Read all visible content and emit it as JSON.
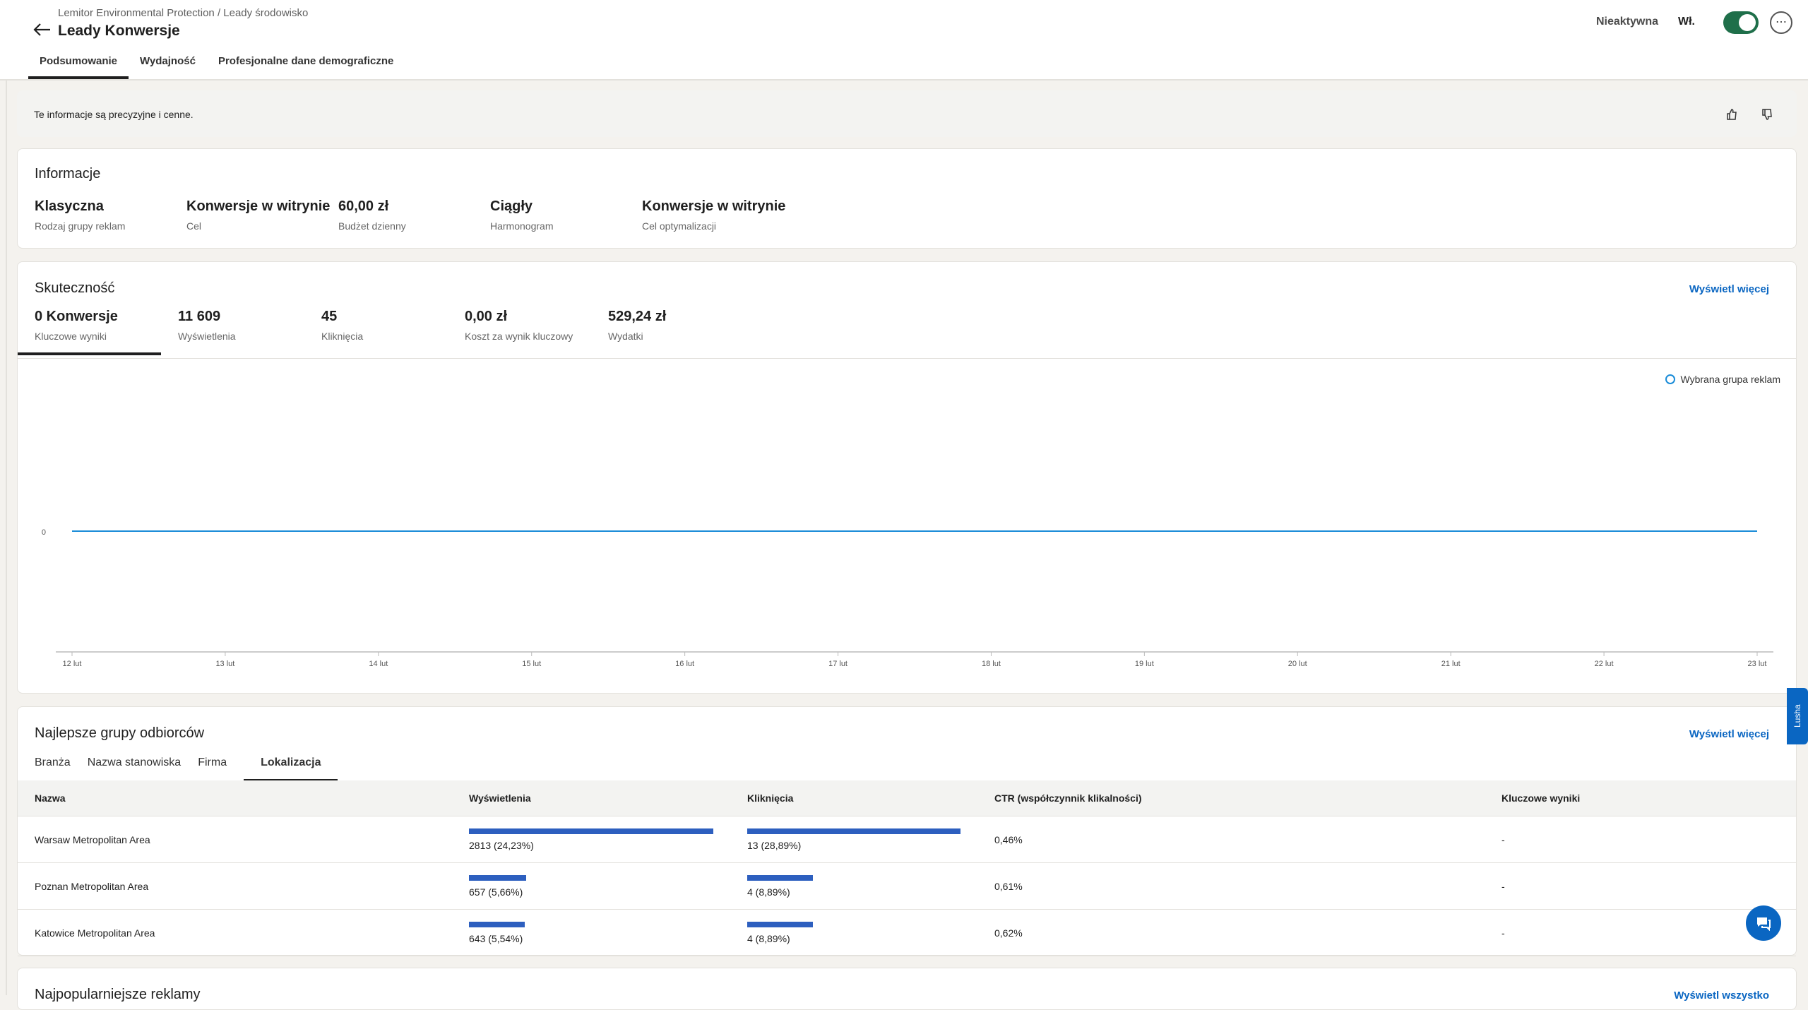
{
  "header": {
    "breadcrumb": "Lemitor Environmental Protection / Leady środowisko",
    "title": "Leady Konwersje",
    "tabs": [
      {
        "label": "Podsumowanie",
        "active": true
      },
      {
        "label": "Wydajność",
        "active": false
      },
      {
        "label": "Profesjonalne dane demograficzne",
        "active": false
      }
    ],
    "status": "Nieaktywna",
    "toggle_label": "Wł.",
    "toggle_on": true
  },
  "notice": {
    "text": "Te informacje są precyzyjne i cenne."
  },
  "info": {
    "title": "Informacje",
    "items": [
      {
        "value": "Klasyczna",
        "label": "Rodzaj grupy reklam"
      },
      {
        "value": "Konwersje w witrynie",
        "label": "Cel"
      },
      {
        "value": "60,00 zł",
        "label": "Budżet dzienny"
      },
      {
        "value": "Ciągły",
        "label": "Harmonogram"
      },
      {
        "value": "Konwersje w witrynie",
        "label": "Cel optymalizacji"
      }
    ]
  },
  "performance": {
    "title": "Skuteczność",
    "view_more": "Wyświetl więcej",
    "metrics": [
      {
        "value": "0 Konwersje",
        "label": "Kluczowe wyniki",
        "active": true
      },
      {
        "value": "11 609",
        "label": "Wyświetlenia",
        "active": false
      },
      {
        "value": "45",
        "label": "Kliknięcia",
        "active": false
      },
      {
        "value": "0,00 zł",
        "label": "Koszt za wynik kluczowy",
        "active": false
      },
      {
        "value": "529,24 zł",
        "label": "Wydatki",
        "active": false
      }
    ]
  },
  "chart_data": {
    "type": "line",
    "categories": [
      "12 lut",
      "13 lut",
      "14 lut",
      "15 lut",
      "16 lut",
      "17 lut",
      "18 lut",
      "19 lut",
      "20 lut",
      "21 lut",
      "22 lut",
      "23 lut"
    ],
    "series": [
      {
        "name": "Wybrana grupa reklam",
        "values": [
          0,
          0,
          0,
          0,
          0,
          0,
          0,
          0,
          0,
          0,
          0,
          0
        ]
      }
    ],
    "ytick_label": "0",
    "legend_position": "top-right",
    "color": "#1a8cd8"
  },
  "audiences": {
    "title": "Najlepsze grupy odbiorców",
    "view_more": "Wyświetl więcej",
    "tabs": [
      {
        "label": "Branża",
        "active": false
      },
      {
        "label": "Nazwa stanowiska",
        "active": false
      },
      {
        "label": "Firma",
        "active": false
      },
      {
        "label": "Lokalizacja",
        "active": true
      }
    ],
    "columns": [
      "Nazwa",
      "Wyświetlenia",
      "Kliknięcia",
      "CTR (współczynnik klikalności)",
      "Kluczowe wyniki"
    ],
    "rows": [
      {
        "name": "Warsaw Metropolitan Area",
        "impressions": "2813 (24,23%)",
        "impressions_share": 24.23,
        "clicks": "13 (28,89%)",
        "clicks_share": 28.89,
        "ctr": "0,46%",
        "key_results": "-"
      },
      {
        "name": "Poznan Metropolitan Area",
        "impressions": "657 (5,66%)",
        "impressions_share": 5.66,
        "clicks": "4 (8,89%)",
        "clicks_share": 8.89,
        "ctr": "0,61%",
        "key_results": "-"
      },
      {
        "name": "Katowice Metropolitan Area",
        "impressions": "643 (5,54%)",
        "impressions_share": 5.54,
        "clicks": "4 (8,89%)",
        "clicks_share": 8.89,
        "ctr": "0,62%",
        "key_results": "-"
      }
    ]
  },
  "bottom": {
    "title": "Najpopularniejsze reklamy",
    "view_all": "Wyświetl wszystko"
  },
  "side_help": "Lusha"
}
